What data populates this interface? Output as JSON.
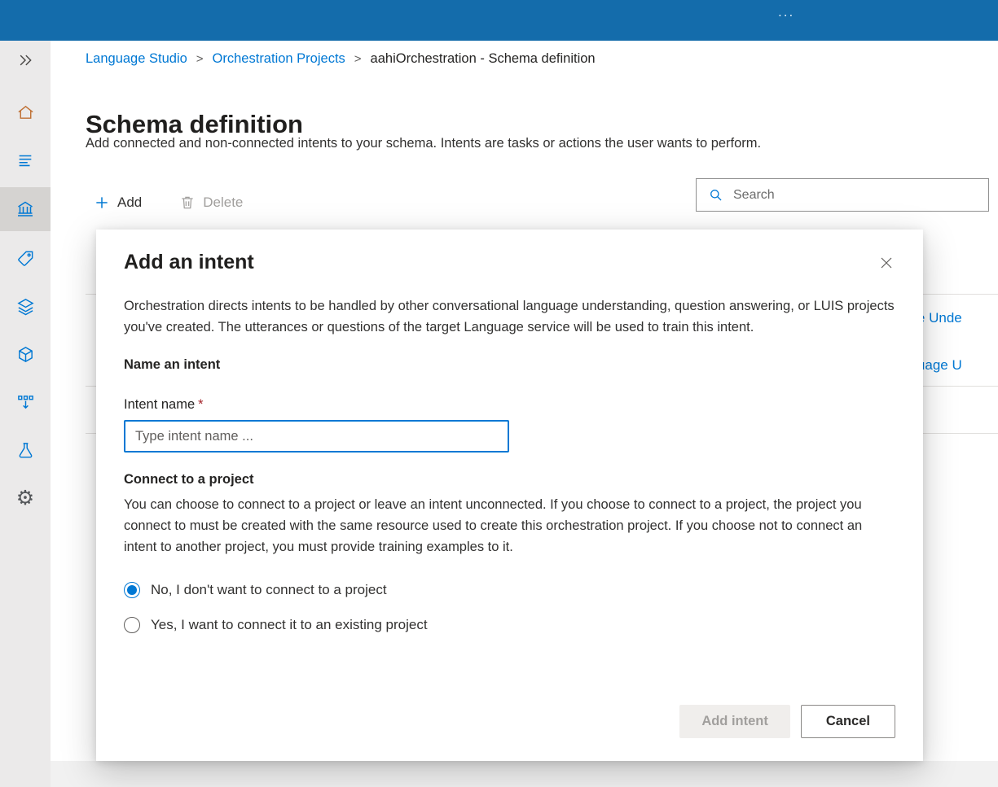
{
  "colors": {
    "accent": "#0078d4",
    "topbar": "#146cab",
    "required": "#a4262c",
    "active_nav_bg": "#d5d3d1"
  },
  "icons": {
    "more": "...",
    "gear": "⚙"
  },
  "topbar": {},
  "sidebar": {
    "icons": [
      "double-chevron-right",
      "home",
      "list",
      "schema",
      "tag",
      "layers",
      "cube",
      "deploy",
      "flask",
      "settings"
    ],
    "active_index": 3
  },
  "breadcrumb": {
    "separator": ">",
    "items": [
      {
        "label": "Language Studio"
      },
      {
        "label": "Orchestration Projects"
      },
      {
        "label": "aahiOrchestration - Schema definition"
      }
    ]
  },
  "page": {
    "title": "Schema definition",
    "subtitle": "Add connected and non-connected intents to your schema. Intents are tasks or actions the user wants to perform."
  },
  "toolbar": {
    "add_label": "Add",
    "delete_label": "Delete"
  },
  "search": {
    "placeholder": "Search"
  },
  "background_table": {
    "fragments": [
      "age Unde",
      "nguage U"
    ]
  },
  "modal": {
    "title": "Add an intent",
    "description": "Orchestration directs intents to be handled by other conversational language understanding, question answering, or LUIS projects you've created. The utterances or questions of the target Language service will be used to train this intent.",
    "name_section_label": "Name an intent",
    "intent_name_label": "Intent name",
    "required_marker": "*",
    "intent_name_placeholder": "Type intent name ...",
    "connect_section_label": "Connect to a project",
    "connect_description": "You can choose to connect to a project or leave an intent unconnected. If you choose to connect to a project, the project you connect to must be created with the same resource used to create this orchestration project. If you choose not to connect an intent to another project, you must provide training examples to it.",
    "radio_options": [
      {
        "label": "No, I don't want to connect to a project",
        "selected": true
      },
      {
        "label": "Yes, I want to connect it to an existing project",
        "selected": false
      }
    ],
    "add_button_label": "Add intent",
    "cancel_button_label": "Cancel"
  }
}
